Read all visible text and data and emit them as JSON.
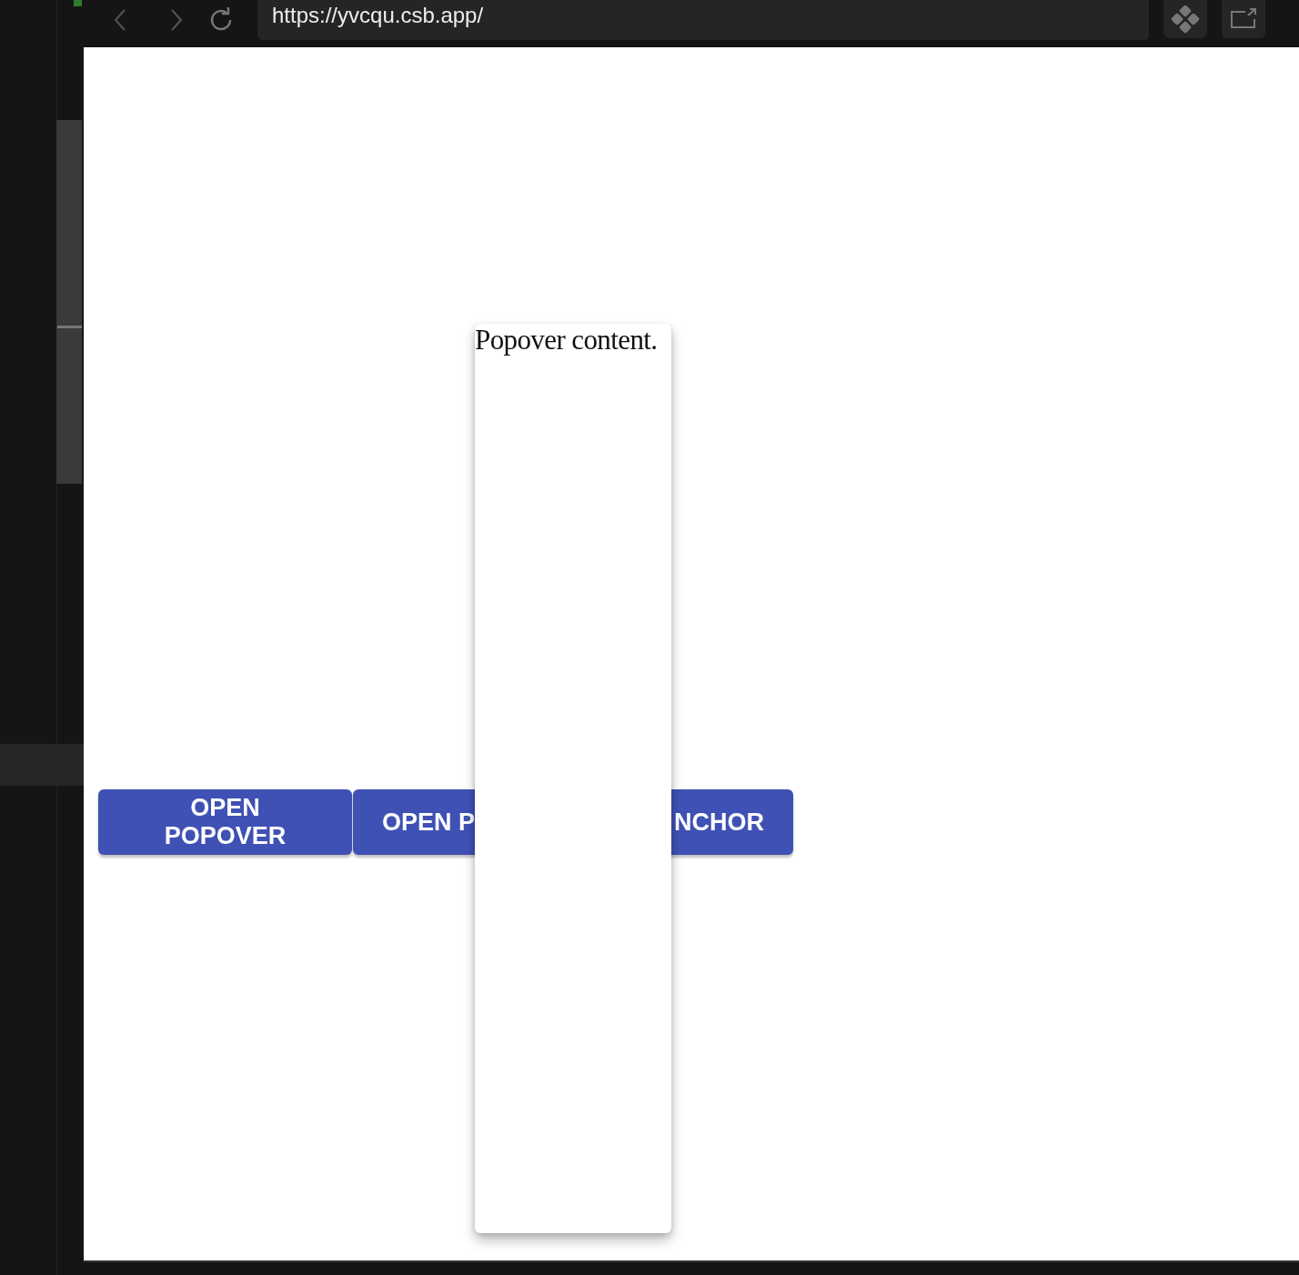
{
  "browser": {
    "url": "https://yvcqu.csb.app/"
  },
  "buttons": [
    {
      "label": "OPEN POPOVER"
    },
    {
      "label_start": "OPEN P",
      "label_end": "NCHOR"
    }
  ],
  "popover": {
    "text": "Popover content."
  }
}
